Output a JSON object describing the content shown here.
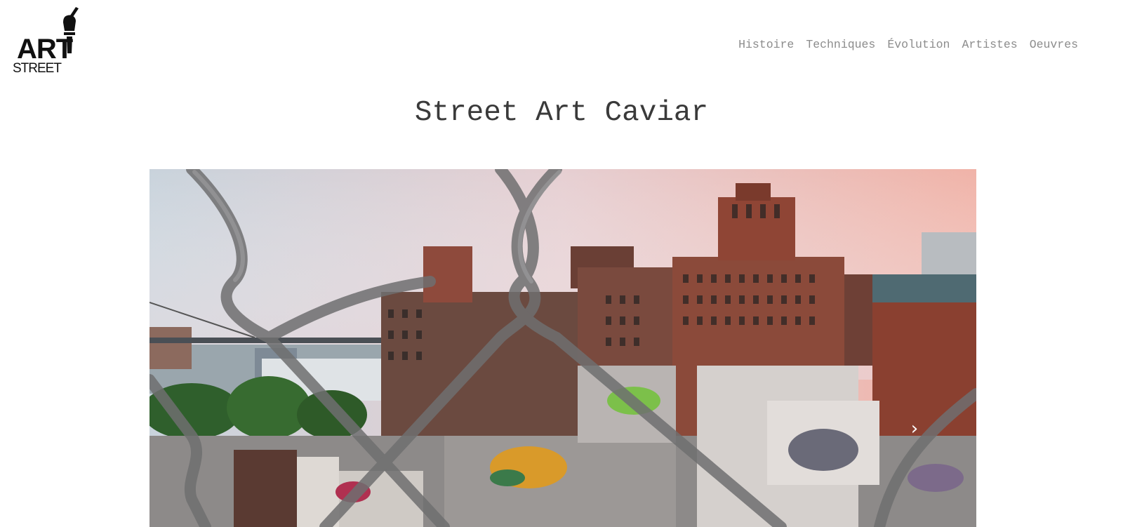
{
  "header": {
    "logo": {
      "line1": "ART",
      "line2": "STREET",
      "icon": "paintbrush-hand-icon"
    },
    "nav": {
      "items": [
        {
          "label": "Histoire"
        },
        {
          "label": "Techniques"
        },
        {
          "label": "Évolution"
        },
        {
          "label": "Artistes"
        },
        {
          "label": "Oeuvres"
        }
      ]
    }
  },
  "main": {
    "title": "Street Art Caviar"
  },
  "carousel": {
    "image_description": "slide-photo",
    "prev_icon": "chevron-left-icon",
    "next_icon": "chevron-right-icon",
    "prev_glyph": "‹",
    "next_glyph": "›"
  },
  "colors": {
    "nav_text": "#8c8c8c",
    "title_text": "#3a3a3a",
    "background": "#ffffff"
  }
}
